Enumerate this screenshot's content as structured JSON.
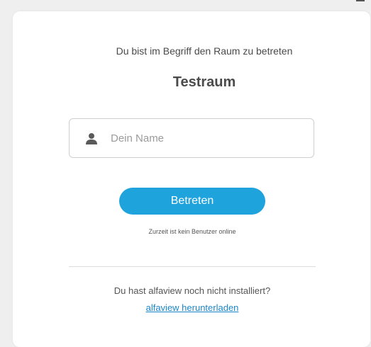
{
  "join": {
    "intro_text": "Du bist im Begriff den Raum zu betreten",
    "room_name": "Testraum",
    "name_input": {
      "placeholder": "Dein Name",
      "value": "",
      "icon": "user-icon"
    },
    "enter_button_label": "Betreten",
    "online_status": "Zurzeit ist kein Benutzer online"
  },
  "install": {
    "prompt": "Du hast alfaview noch nicht installiert?",
    "download_link": "alfaview herunterladen"
  },
  "colors": {
    "accent": "#1fa3dc",
    "link": "#1c86c8",
    "background": "#efefef",
    "card": "#ffffff"
  }
}
